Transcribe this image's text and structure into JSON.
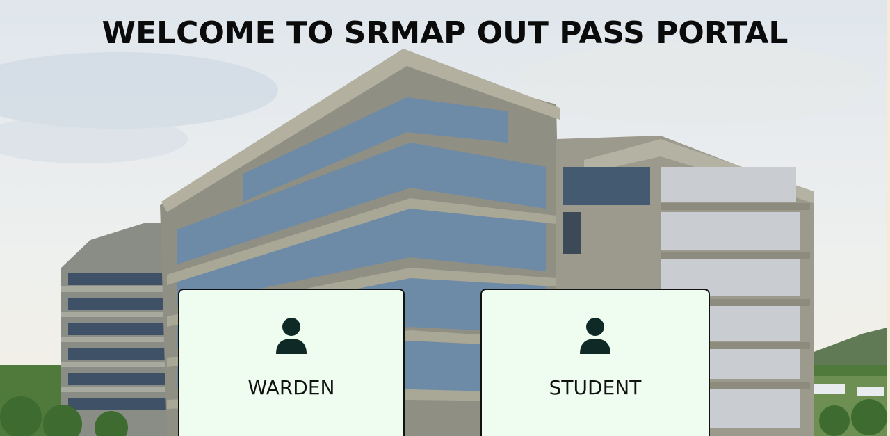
{
  "header": {
    "title": "WELCOME TO SRMAP OUT PASS PORTAL"
  },
  "roles": [
    {
      "label": "WARDEN",
      "icon": "user-icon"
    },
    {
      "label": "STUDENT",
      "icon": "user-icon"
    }
  ],
  "theme": {
    "card_background": "#eefdf0",
    "card_border": "#111111",
    "text_color": "#0b0b0b"
  }
}
